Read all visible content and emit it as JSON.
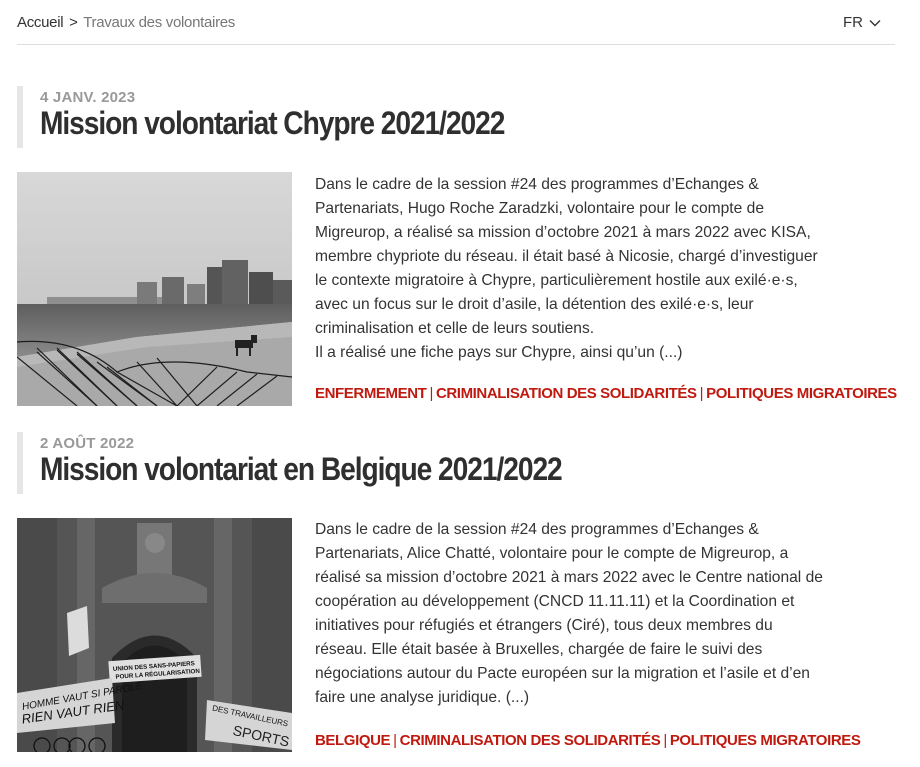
{
  "breadcrumb": {
    "home": "Accueil",
    "separator": ">",
    "current": "Travaux des volontaires"
  },
  "language": {
    "label": "FR",
    "icon": "chevron-down-icon"
  },
  "colors": {
    "accent": "#c0190f",
    "date": "#999999",
    "title": "#2f2f2f"
  },
  "articles": [
    {
      "date": "4 JANV. 2023",
      "title": "Mission volontariat Chypre 2021/2022",
      "excerpt_lines": [
        "Dans le cadre de la session #24 des programmes d’Echanges &",
        "Partenariats, Hugo Roche Zaradzki, volontaire pour le compte de",
        "Migreurop, a réalisé sa mission d’octobre 2021 à mars 2022 avec KISA,",
        "membre chypriote du réseau. il était basé à Nicosie, chargé d’investiguer",
        "le contexte migratoire à Chypre, particulièrement hostile aux exilé·e·s,",
        "avec un focus sur le droit d’asile, la détention des exilé·e·s, leur",
        "criminalisation et celle de leurs soutiens.",
        "Il a réalisé une fiche pays sur Chypre, ainsi qu’un (...)"
      ],
      "tags": [
        "ENFERMEMENT",
        "CRIMINALISATION DES SOLIDARITÉS",
        "POLITIQUES MIGRATOIRES"
      ]
    },
    {
      "date": "2 AOÛT 2022",
      "title": "Mission volontariat en Belgique 2021/2022",
      "excerpt_lines": [
        "Dans le cadre de la session #24 des programmes d’Echanges &",
        "Partenariats, Alice Chatté, volontaire pour le compte de Migreurop, a",
        "réalisé sa mission d’octobre 2021 à mars 2022 avec le Centre national de",
        "coopération au développement (CNCD 11.11.11) et la Coordination et",
        "initiatives pour réfugiés et étrangers (Ciré), tous deux membres du",
        "réseau. Elle était basée à Bruxelles, chargée de faire le suivi des",
        "négociations autour du Pacte européen sur la migration et l’asile et d’en",
        "faire une analyse juridique. (...)"
      ],
      "tags": [
        "BELGIQUE",
        "CRIMINALISATION DES SOLIDARITÉS",
        "POLITIQUES MIGRATOIRES"
      ],
      "photo_text": {
        "banner": "UNION DES SANS-PAPIERS POUR LA RÉGULARISATION",
        "sign_left_1": "HOMME VAUT SI PAROLE",
        "sign_left_2": "RIEN VAUT RIEN",
        "sign_right": "DES TRAVAILLEURS SPORTS"
      },
      "tag_separator": "|"
    }
  ]
}
